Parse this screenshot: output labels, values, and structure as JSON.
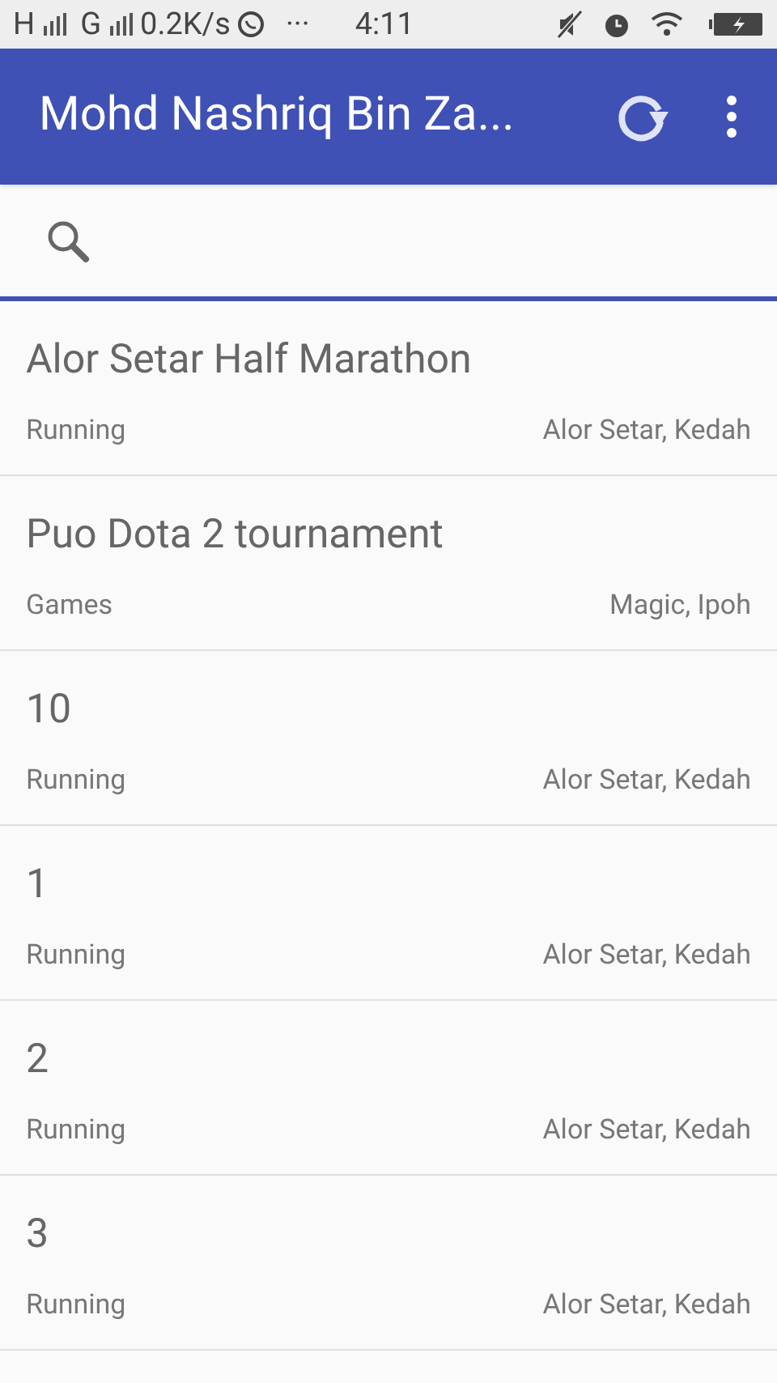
{
  "status_bar": {
    "network_1": "H",
    "network_2": "G",
    "speed": "0.2K/s",
    "more": "···",
    "time": "4:11"
  },
  "app_bar": {
    "title": "Mohd Nashriq Bin Za..."
  },
  "events": [
    {
      "title": "Alor Setar Half Marathon",
      "category": "Running",
      "location": "Alor Setar, Kedah"
    },
    {
      "title": "Puo Dota 2 tournament",
      "category": "Games",
      "location": "Magic, Ipoh"
    },
    {
      "title": "10",
      "category": "Running",
      "location": "Alor Setar, Kedah"
    },
    {
      "title": "1",
      "category": "Running",
      "location": "Alor Setar, Kedah"
    },
    {
      "title": "2",
      "category": "Running",
      "location": "Alor Setar, Kedah"
    },
    {
      "title": "3",
      "category": "Running",
      "location": "Alor Setar, Kedah"
    }
  ]
}
